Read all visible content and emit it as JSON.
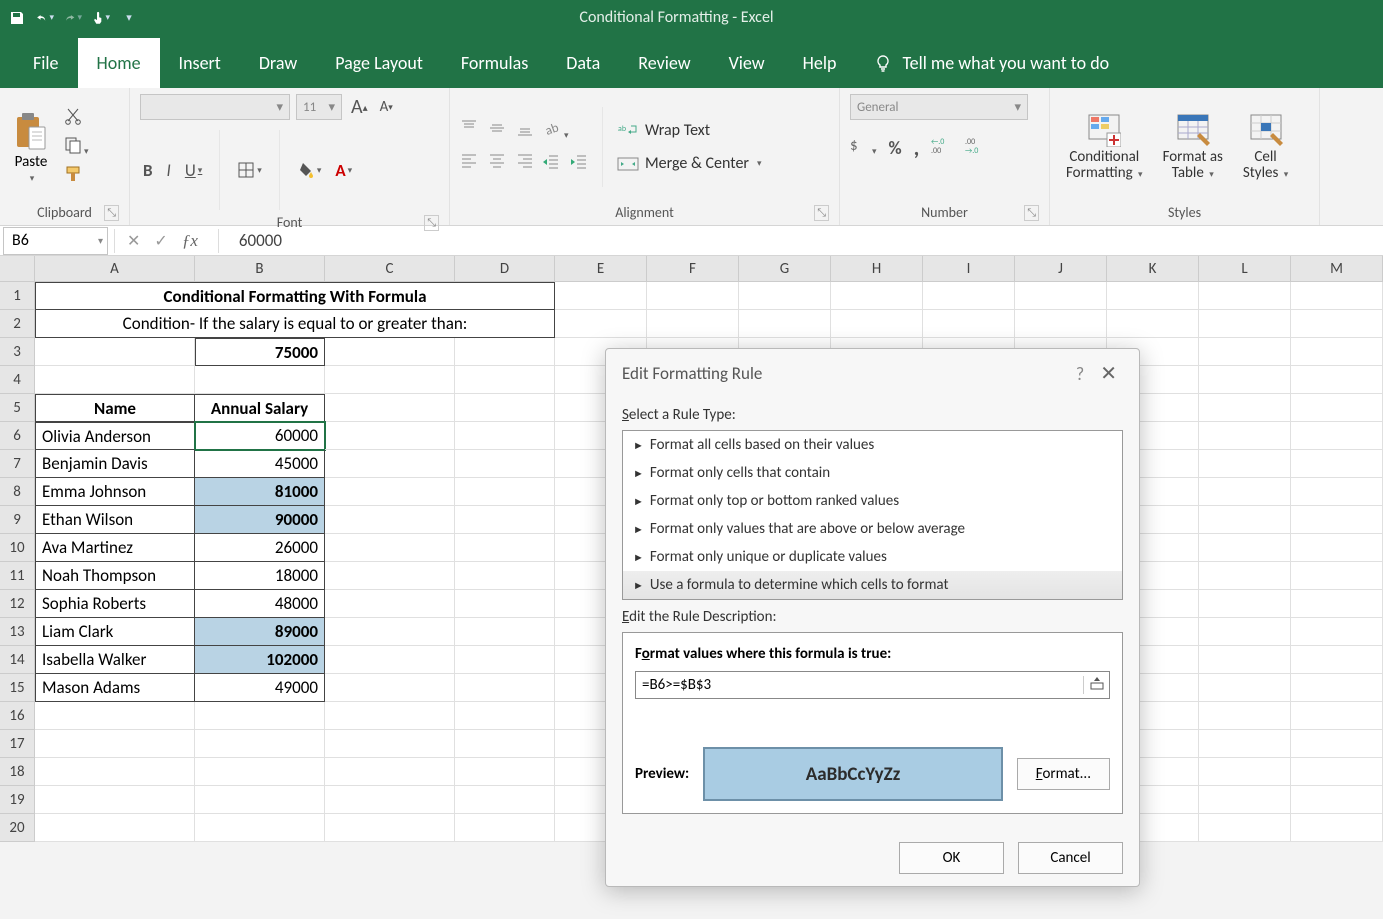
{
  "app": {
    "title": "Conditional Formatting  -  Excel"
  },
  "tabs": [
    "File",
    "Home",
    "Insert",
    "Draw",
    "Page Layout",
    "Formulas",
    "Data",
    "Review",
    "View",
    "Help"
  ],
  "tellme": "Tell me what you want to do",
  "ribbon": {
    "clipboard": {
      "paste": "Paste",
      "label": "Clipboard"
    },
    "font": {
      "size": "11",
      "label": "Font",
      "bold": "B",
      "italic": "I",
      "underline": "U"
    },
    "alignment": {
      "label": "Alignment",
      "wrap": "Wrap Text",
      "merge": "Merge & Center"
    },
    "number": {
      "label": "Number",
      "format": "General"
    },
    "styles": {
      "label": "Styles",
      "cond": "Conditional Formatting",
      "table": "Format as Table",
      "cell": "Cell Styles"
    }
  },
  "namebox": "B6",
  "formula": "60000",
  "columns": [
    "A",
    "B",
    "C",
    "D",
    "E",
    "F",
    "G",
    "H",
    "I",
    "J",
    "K",
    "L",
    "M"
  ],
  "sheet": {
    "title": "Conditional Formatting With Formula",
    "condition": "Condition- If the salary is equal to or greater than:",
    "threshold": "75000",
    "headers": {
      "name": "Name",
      "salary": "Annual Salary"
    },
    "rows": [
      {
        "name": "Olivia Anderson",
        "salary": "60000",
        "hl": false
      },
      {
        "name": "Benjamin Davis",
        "salary": "45000",
        "hl": false
      },
      {
        "name": "Emma Johnson",
        "salary": "81000",
        "hl": true
      },
      {
        "name": "Ethan Wilson",
        "salary": "90000",
        "hl": true
      },
      {
        "name": "Ava Martinez",
        "salary": "26000",
        "hl": false
      },
      {
        "name": "Noah Thompson",
        "salary": "18000",
        "hl": false
      },
      {
        "name": "Sophia Roberts",
        "salary": "48000",
        "hl": false
      },
      {
        "name": "Liam Clark",
        "salary": "89000",
        "hl": true
      },
      {
        "name": "Isabella Walker",
        "salary": "102000",
        "hl": true
      },
      {
        "name": "Mason Adams",
        "salary": "49000",
        "hl": false
      }
    ]
  },
  "dialog": {
    "title": "Edit Formatting Rule",
    "select_label": "Select a Rule Type:",
    "rules": [
      "Format all cells based on their values",
      "Format only cells that contain",
      "Format only top or bottom ranked values",
      "Format only values that are above or below average",
      "Format only unique or duplicate values",
      "Use a formula to determine which cells to format"
    ],
    "edit_label": "Edit the Rule Description:",
    "formula_label": "Format values where this formula is true:",
    "formula_value": "=B6>=$B$3",
    "preview_label": "Preview:",
    "preview_sample": "AaBbCcYyZz",
    "format_btn": "Format...",
    "ok": "OK",
    "cancel": "Cancel"
  }
}
